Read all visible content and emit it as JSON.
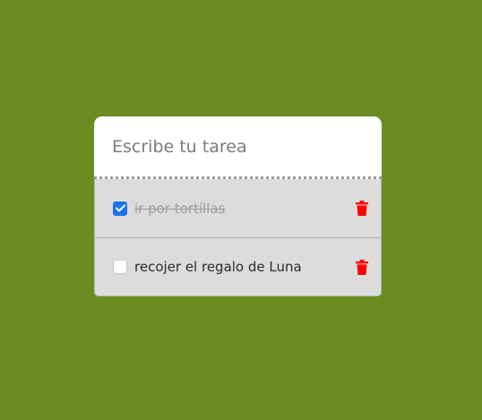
{
  "input": {
    "placeholder": "Escribe tu tarea",
    "value": ""
  },
  "tasks": [
    {
      "label": "ir por tortillas",
      "completed": true
    },
    {
      "label": "recojer el regalo de Luna",
      "completed": false
    }
  ],
  "colors": {
    "background": "#6b8c21",
    "checkbox_accent": "#1a73e8",
    "delete_icon": "#ff0000"
  },
  "icons": {
    "check": "check-icon",
    "delete": "trash-icon"
  }
}
